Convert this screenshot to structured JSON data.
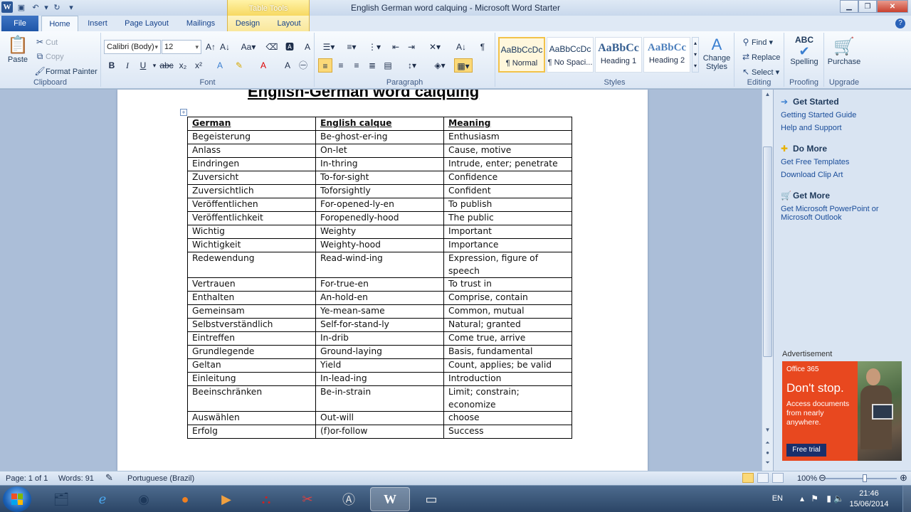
{
  "window": {
    "title": "English German word calquing  -  Microsoft Word Starter",
    "contextual_tab_group": "Table Tools",
    "qat": {
      "save": "save-icon",
      "undo": "undo-icon",
      "redo": "redo-icon"
    }
  },
  "tabs": {
    "file": "File",
    "home": "Home",
    "insert": "Insert",
    "page_layout": "Page Layout",
    "mailings": "Mailings",
    "design": "Design",
    "layout": "Layout",
    "active": "Home"
  },
  "ribbon": {
    "clipboard": {
      "label": "Clipboard",
      "paste": "Paste",
      "cut": "Cut",
      "copy": "Copy",
      "format_painter": "Format Painter"
    },
    "font": {
      "label": "Font",
      "family": "Calibri (Body)",
      "size": "12"
    },
    "paragraph": {
      "label": "Paragraph"
    },
    "styles": {
      "label": "Styles",
      "items": [
        {
          "sample": "AaBbCcDc",
          "name": "¶ Normal",
          "selected": true
        },
        {
          "sample": "AaBbCcDc",
          "name": "¶ No Spaci...",
          "selected": false
        },
        {
          "sample": "AaBbCc",
          "name": "Heading 1",
          "selected": false
        },
        {
          "sample": "AaBbCc",
          "name": "Heading 2",
          "selected": false
        }
      ],
      "change_styles": "Change Styles"
    },
    "editing": {
      "label": "Editing",
      "find": "Find",
      "replace": "Replace",
      "select": "Select"
    },
    "proofing": {
      "label": "Proofing",
      "spelling": "Spelling"
    },
    "upgrade": {
      "label": "Upgrade",
      "purchase": "Purchase"
    }
  },
  "document": {
    "title": "English-German word calquing",
    "table": {
      "headers": [
        "German",
        "English calque",
        "Meaning"
      ],
      "rows": [
        [
          "Begeisterung",
          "Be-ghost-er-ing",
          "Enthusiasm"
        ],
        [
          "Anlass",
          "On-let",
          "Cause, motive"
        ],
        [
          "Eindringen",
          "In-thring",
          "Intrude,  enter; penetrate"
        ],
        [
          "Zuversicht",
          "To-for-sight",
          "Confidence"
        ],
        [
          "Zuversichtlich",
          "Toforsightly",
          "Confident"
        ],
        [
          "Veröffentlichen",
          "For-opened-ly-en",
          "To publish"
        ],
        [
          "Veröffentlichkeit",
          "Foropenedly-hood",
          "The public"
        ],
        [
          "Wichtig",
          "Weighty",
          "Important"
        ],
        [
          "Wichtigkeit",
          "Weighty-hood",
          "Importance"
        ],
        [
          "Redewendung",
          "Read-wind-ing",
          "Expression, figure of speech"
        ],
        [
          "Vertrauen",
          "For-true-en",
          "To trust in"
        ],
        [
          "Enthalten",
          "An-hold-en",
          "Comprise, contain"
        ],
        [
          "Gemeinsam",
          "Ye-mean-same",
          "Common, mutual"
        ],
        [
          "Selbstverständlich",
          "Self-for-stand-ly",
          "Natural; granted"
        ],
        [
          "Eintreffen",
          "In-drib",
          "Come true, arrive"
        ],
        [
          "Grundlegende",
          "Ground-laying",
          "Basis, fundamental"
        ],
        [
          "Geltan",
          "Yield",
          "Count, applies; be valid"
        ],
        [
          "Einleitung",
          "In-lead-ing",
          "Introduction"
        ],
        [
          "Beeinschränken",
          "Be-in-strain",
          "Limit; constrain; economize"
        ],
        [
          "Auswählen",
          "Out-will",
          "choose"
        ],
        [
          "Erfolg",
          "(f)or-follow",
          "Success"
        ]
      ]
    }
  },
  "taskpane": {
    "get_started": {
      "title": "Get Started",
      "links": [
        "Getting Started Guide",
        "Help and Support"
      ]
    },
    "do_more": {
      "title": "Do More",
      "links": [
        "Get Free Templates",
        "Download Clip Art"
      ]
    },
    "get_more": {
      "title": "Get More",
      "links": [
        "Get Microsoft PowerPoint or Microsoft Outlook"
      ]
    },
    "advertisement_label": "Advertisement",
    "ad": {
      "brand": "Office 365",
      "headline": "Don't stop.",
      "body": "Access documents from nearly anywhere.",
      "cta": "Free trial"
    }
  },
  "status": {
    "page": "Page: 1 of 1",
    "words": "Words: 91",
    "language": "Portuguese (Brazil)",
    "zoom": "100%",
    "zoom_level": 1.0
  },
  "taskbar": {
    "apps": [
      "explorer-icon",
      "ie-icon",
      "chrome-icon",
      "firefox-icon",
      "media-player-icon",
      "acrobat-icon",
      "snipping-tool-icon",
      "dictionary-icon",
      "word-icon",
      "folder-icon"
    ],
    "active_app": "word-icon",
    "language": "EN",
    "time": "21:46",
    "date": "15/06/2014"
  }
}
